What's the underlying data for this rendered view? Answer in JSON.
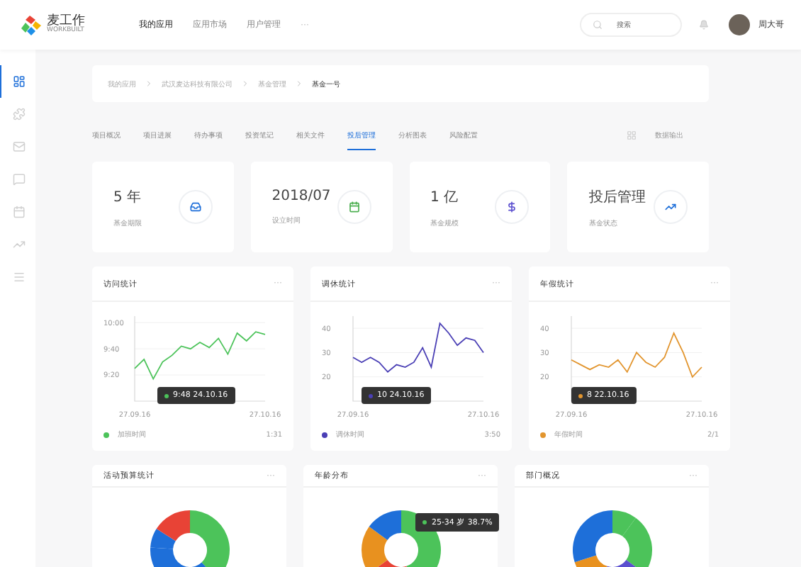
{
  "header": {
    "logo": {
      "name": "麦工作",
      "subtitle": "WORKBUILT"
    },
    "nav": [
      {
        "label": "我的应用",
        "selected": true
      },
      {
        "label": "应用市场",
        "selected": false
      },
      {
        "label": "用户管理",
        "selected": false
      }
    ],
    "more": "···",
    "search": {
      "placeholder": "搜索"
    },
    "user": {
      "name": "周大哥"
    }
  },
  "sidebar": {
    "items": [
      {
        "selected": true
      },
      {
        "selected": false
      },
      {
        "selected": false
      },
      {
        "selected": false
      },
      {
        "selected": false
      },
      {
        "selected": false
      },
      {
        "selected": false
      }
    ]
  },
  "breadcrumb": [
    "我的应用",
    "武汉麦达科技有限公司",
    "基金管理",
    "基金一号"
  ],
  "tabs": [
    {
      "label": "项目概况",
      "selected": false
    },
    {
      "label": "项目进展",
      "selected": false
    },
    {
      "label": "待办事项",
      "selected": false
    },
    {
      "label": "投资笔记",
      "selected": false
    },
    {
      "label": "相关文件",
      "selected": false
    },
    {
      "label": "投后管理",
      "selected": true
    },
    {
      "label": "分析图表",
      "selected": false
    },
    {
      "label": "风险配置",
      "selected": false
    }
  ],
  "export": {
    "label": "数据输出"
  },
  "stats": [
    {
      "value": "5 年",
      "label": "基金期限",
      "kind": "inbox",
      "color": "#1e6fd9"
    },
    {
      "value": "2018/07",
      "label": "设立时间",
      "kind": "calendar",
      "color": "#4caf50"
    },
    {
      "value": "1 亿",
      "label": "基金规模",
      "kind": "money",
      "color": "#5b4fcf"
    },
    {
      "value": "投后管理",
      "label": "基金状态",
      "kind": "trend",
      "color": "#1e6fd9"
    }
  ],
  "line_cards": [
    {
      "title": "访问统计",
      "more": "···",
      "tooltip": "9:48  24.10.16",
      "legend_value": "1:31",
      "chart_data": {
        "type": "line",
        "grid": true,
        "categories": [
          "27.09.16",
          null,
          null,
          null,
          null,
          null,
          null,
          null,
          null,
          null,
          null,
          null,
          null,
          null,
          "27.10.16"
        ],
        "ylim": [
          540,
          605
        ],
        "yticks": [
          {
            "value": 600,
            "label": "10:00"
          },
          {
            "value": 580,
            "label": "9:40"
          },
          {
            "value": 560,
            "label": "9:20"
          }
        ],
        "series": [
          {
            "name": "加班时间",
            "color": "#4cc35a",
            "values": [
              565,
              572,
              557,
              570,
              575,
              582,
              580,
              585,
              581,
              588,
              576,
              592,
              586,
              593,
              591
            ]
          }
        ]
      }
    },
    {
      "title": "调休统计",
      "more": "···",
      "tooltip": "10  24.10.16",
      "legend_value": "3:50",
      "chart_data": {
        "type": "line",
        "grid": true,
        "categories": [
          "27.09.16",
          null,
          null,
          null,
          null,
          null,
          null,
          null,
          null,
          null,
          null,
          null,
          null,
          null,
          null,
          "27.10.16"
        ],
        "ylim": [
          10,
          45
        ],
        "yticks": [
          40,
          30,
          20
        ],
        "series": [
          {
            "name": "调休时间",
            "color": "#4a3fb5",
            "values": [
              28,
              26,
              28,
              26,
              22,
              25,
              24,
              26,
              32,
              24,
              42,
              38,
              33,
              36,
              35,
              30
            ]
          }
        ]
      }
    },
    {
      "title": "年假统计",
      "more": "···",
      "tooltip": "8  22.10.16",
      "legend_value": "2/1",
      "chart_data": {
        "type": "line",
        "grid": true,
        "categories": [
          "27.09.16",
          null,
          null,
          null,
          null,
          null,
          null,
          null,
          null,
          null,
          null,
          null,
          null,
          null,
          "27.10.16"
        ],
        "ylim": [
          10,
          45
        ],
        "yticks": [
          40,
          30,
          20
        ],
        "series": [
          {
            "name": "年假时间",
            "color": "#e2952e",
            "values": [
              27,
              25,
              23,
              25,
              24,
              27,
              22,
              30,
              26,
              24,
              28,
              38,
              30,
              20,
              24
            ]
          }
        ]
      }
    }
  ],
  "donut_cards": [
    {
      "title": "活动预算统计",
      "more": "···"
    },
    {
      "title": "年龄分布",
      "more": "···",
      "tooltip": "25-34 岁 38.7%"
    },
    {
      "title": "部门概况",
      "more": "···"
    }
  ]
}
